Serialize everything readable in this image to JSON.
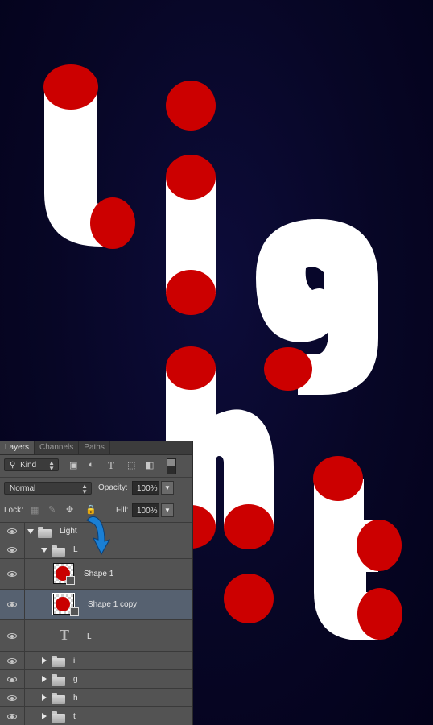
{
  "artwork": {
    "word": "Light",
    "letter_color": "#ffffff",
    "dot_color": "#cc0000",
    "background_color": "#07062a"
  },
  "layers_panel": {
    "tabs": [
      {
        "label": "Layers",
        "active": true
      },
      {
        "label": "Channels",
        "active": false
      },
      {
        "label": "Paths",
        "active": false
      }
    ],
    "filter": {
      "kind_label": "Kind",
      "filter_icons": [
        "pixel-filter-icon",
        "adjustment-filter-icon",
        "type-filter-icon",
        "shape-filter-icon",
        "smart-object-filter-icon"
      ]
    },
    "blend_mode": "Normal",
    "opacity_label": "Opacity:",
    "opacity_value": "100%",
    "lock_label": "Lock:",
    "lock_icons": [
      "lock-transparent-icon",
      "lock-image-icon",
      "lock-position-icon",
      "lock-all-icon"
    ],
    "fill_label": "Fill:",
    "fill_value": "100%",
    "layers": [
      {
        "name": "Light",
        "type": "group",
        "expanded": true,
        "indent": 0,
        "visible": true
      },
      {
        "name": "L",
        "type": "group",
        "expanded": true,
        "indent": 1,
        "visible": true
      },
      {
        "name": "Shape 1",
        "type": "shape",
        "indent": 2,
        "visible": true,
        "selected": false
      },
      {
        "name": "Shape 1 copy",
        "type": "shape",
        "indent": 2,
        "visible": true,
        "selected": true
      },
      {
        "name": "L",
        "type": "text",
        "indent": 2,
        "visible": true
      },
      {
        "name": "i",
        "type": "group",
        "expanded": false,
        "indent": 1,
        "visible": true
      },
      {
        "name": "g",
        "type": "group",
        "expanded": false,
        "indent": 1,
        "visible": true
      },
      {
        "name": "h",
        "type": "group",
        "expanded": false,
        "indent": 1,
        "visible": true
      },
      {
        "name": "t",
        "type": "group",
        "expanded": false,
        "indent": 1,
        "visible": true
      }
    ]
  },
  "annotation": {
    "arrow_color": "#1a7fd4",
    "arrow_icon": "curved-arrow-icon"
  }
}
